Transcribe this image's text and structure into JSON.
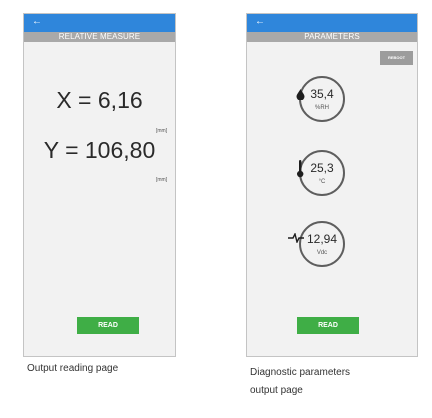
{
  "output_reading": {
    "title": "RELATIVE MEASURE",
    "x_reading": "X = 6,16",
    "x_unit": "[mm]",
    "y_reading": "Y = 106,80",
    "y_unit": "[mm]",
    "read_label": "READ",
    "caption": "Output reading page"
  },
  "diagnostics": {
    "title": "PARAMETERS",
    "reboot_label": "REBOOT",
    "gauges": [
      {
        "value": "35,4",
        "unit": "%RH",
        "icon": "humidity-drop-icon"
      },
      {
        "value": "25,3",
        "unit": "°C",
        "icon": "thermometer-icon"
      },
      {
        "value": "12,94",
        "unit": "Vdc",
        "icon": "voltage-pulse-icon"
      }
    ],
    "read_label": "READ",
    "caption_line1": "Diagnostic parameters",
    "caption_line2": "output page"
  },
  "colors": {
    "app_bar": "#2f86db",
    "title_bar": "#a9a9a9",
    "read_button": "#3fae46",
    "reboot_button": "#9c9c9c"
  }
}
